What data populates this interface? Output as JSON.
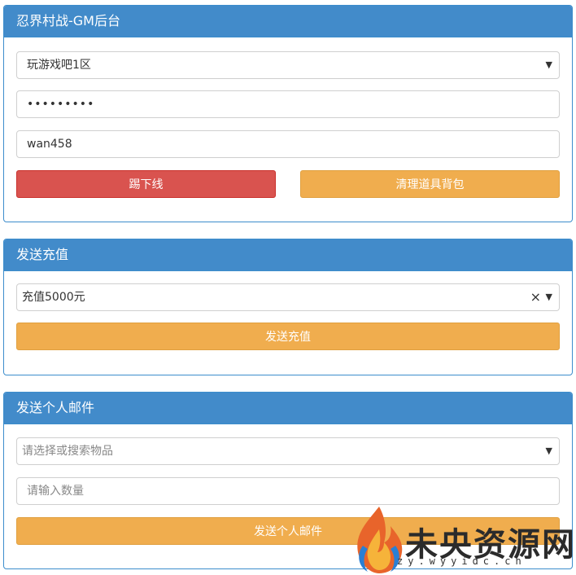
{
  "panel1": {
    "title": "忍界村战-GM后台",
    "server_select": "玩游戏吧1区",
    "password_value": "•••••••••",
    "username_value": "wan458",
    "kick_button": "踢下线",
    "clear_bag_button": "清理道具背包"
  },
  "panel2": {
    "title": "发送充值",
    "recharge_select": "充值5000元",
    "clear_glyph": "×",
    "send_button": "发送充值"
  },
  "panel3": {
    "title": "发送个人邮件",
    "item_select_placeholder": "请选择或搜索物品",
    "quantity_placeholder": "请输入数量",
    "send_button": "发送个人邮件"
  },
  "watermark": {
    "text": "未央资源网",
    "sub": "zy.wyyidc.cn"
  },
  "colors": {
    "header": "#428bca",
    "danger": "#d9534f",
    "warning": "#f0ad4e"
  },
  "icons": {
    "dropdown": "chevron-down-icon",
    "clear": "close-icon",
    "watermark": "flame-logo-icon"
  }
}
